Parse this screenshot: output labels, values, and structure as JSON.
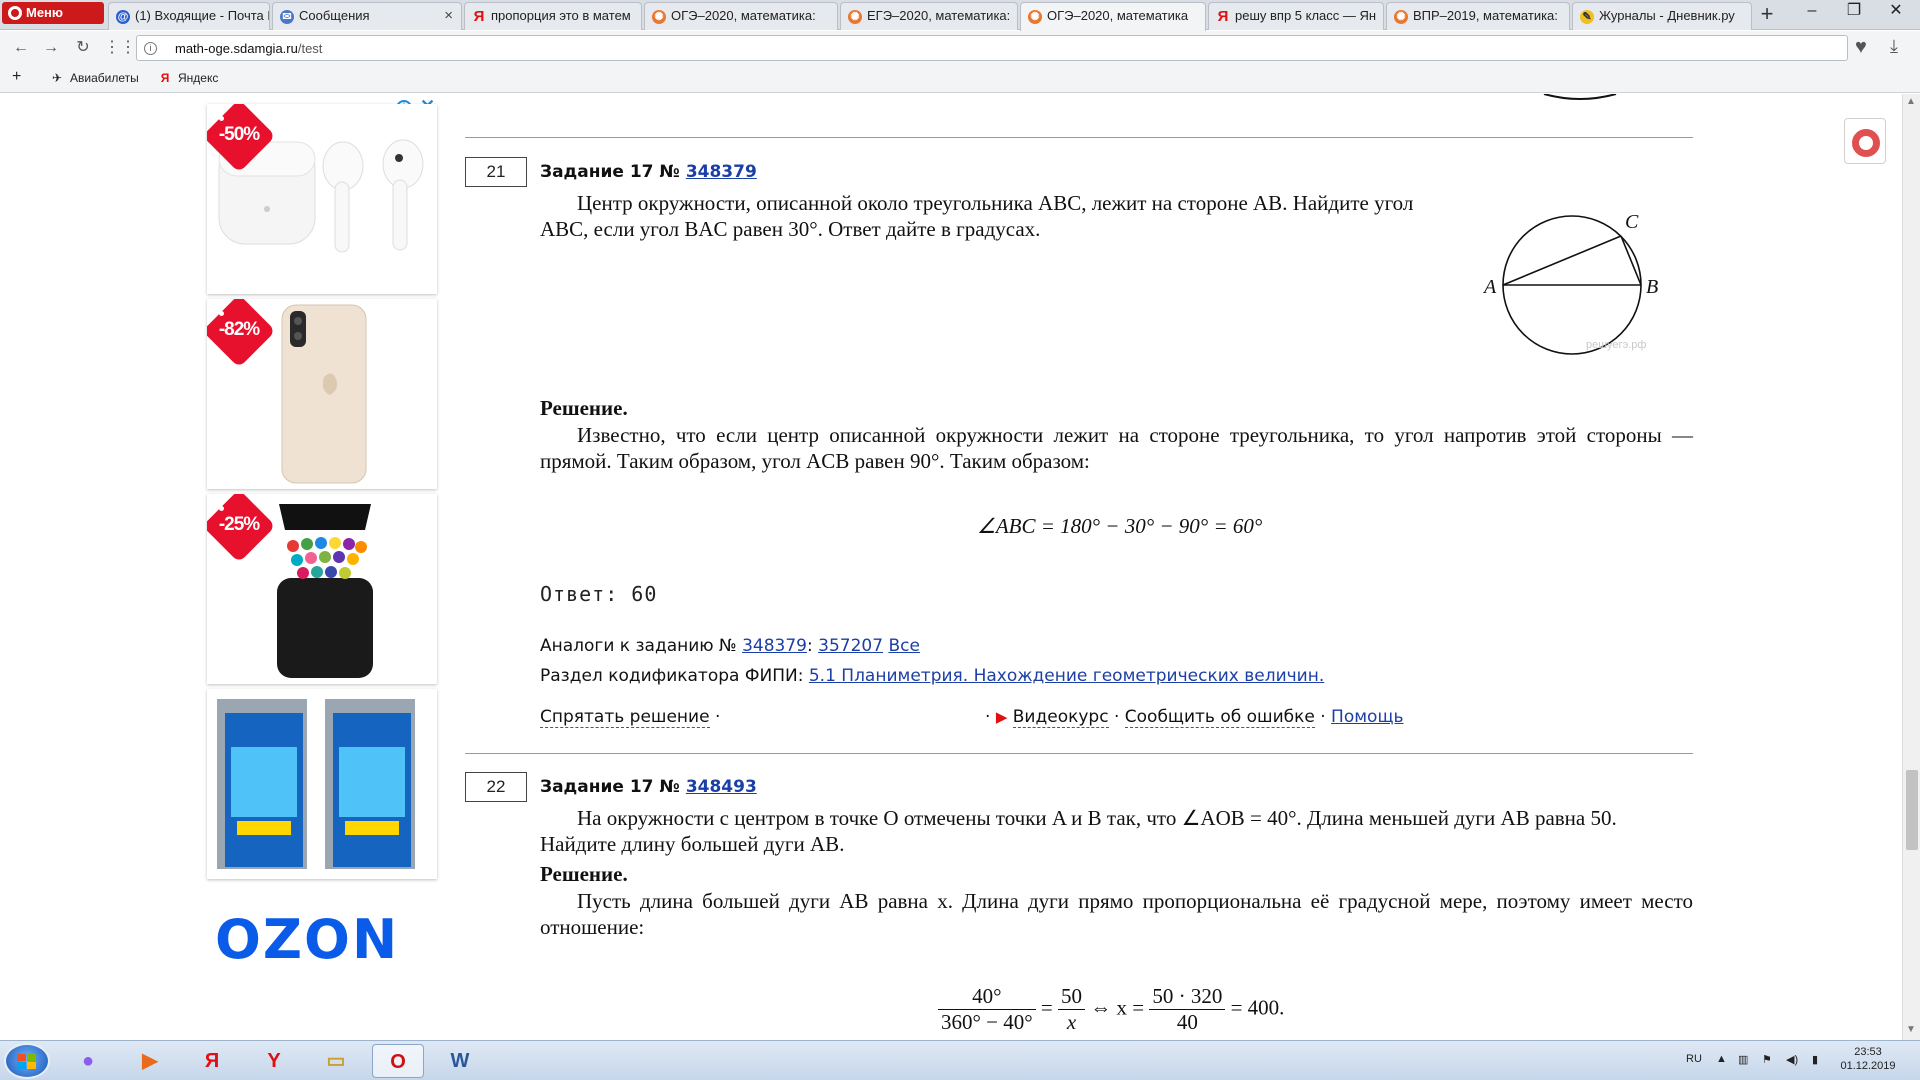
{
  "browser": {
    "menu_label": "Меню",
    "tabs": [
      {
        "label": "(1) Входящие - Почта М",
        "icon": "mail-icon"
      },
      {
        "label": "Сообщения",
        "icon": "messages-icon"
      },
      {
        "label": "пропорция это в матем",
        "icon": "yandex-icon"
      },
      {
        "label": "ОГЭ–2020, математика:",
        "icon": "sdamgia-icon"
      },
      {
        "label": "ЕГЭ–2020, математика:",
        "icon": "sdamgia-icon"
      },
      {
        "label": "ОГЭ–2020, математика",
        "icon": "sdamgia-icon"
      },
      {
        "label": "решу впр 5 класс — Ян",
        "icon": "yandex-icon"
      },
      {
        "label": "ВПР–2019, математика:",
        "icon": "sdamgia-icon"
      },
      {
        "label": "Журналы - Дневник.ру",
        "icon": "dnevnik-icon"
      }
    ],
    "active_tab": 5,
    "url_domain": "math-oge.sdamgia.ru",
    "url_path": "/test",
    "bookmarks": [
      {
        "label": "Авиабилеты",
        "icon": "plane-icon"
      },
      {
        "label": "Яндекс",
        "icon": "yandex-icon"
      }
    ]
  },
  "ads": {
    "items": [
      {
        "discount": "-50%",
        "product": "wireless earbuds"
      },
      {
        "discount": "-82%",
        "product": "phone case"
      },
      {
        "discount": "-25%",
        "product": "markers set"
      },
      {
        "discount": "",
        "product": "trading cards"
      }
    ],
    "brand": "OZON"
  },
  "task21": {
    "number": "21",
    "title_prefix": "Задание 17 № ",
    "id": "348379",
    "condition_1": "Центр окружности, описанной около треугольника ABC, лежит на стороне AB. Найдите угол",
    "condition_2": "ABC, если угол BAC равен 30°. Ответ дайте в градусах.",
    "figure_labels": {
      "a": "A",
      "b": "B",
      "c": "C",
      "watermark": "решуегэ.рф"
    },
    "solution_title": "Решение.",
    "solution_text": "Известно, что если центр описанной окружности лежит на стороне треугольника, то угол напротив этой стороны — прямой. Таким образом, угол ACB равен 90°. Таким образом:",
    "formula": "∠ABC = 180° − 30° − 90° = 60°",
    "answer": "Ответ: 60",
    "analogs_label": "Аналоги к заданию № ",
    "analogs_id": "348379",
    "analogs_sep": ": ",
    "analog_1": "357207",
    "analogs_all": "Все",
    "codifier_label": "Раздел кодификатора ФИПИ: ",
    "codifier_link": "5.1 Планиметрия. Нахождение геометрических величин.",
    "hide_solution": "Спрятать решение",
    "video": "Видеокурс",
    "report": "Сообщить об ошибке",
    "help": "Помощь"
  },
  "task22": {
    "number": "22",
    "title_prefix": "Задание 17 № ",
    "id": "348493",
    "condition_1": "На окружности с центром в точке  O отмечены точки  A и  B так, что  ∠AOB = 40°. Длина меньшей дуги  AB равна 50.",
    "condition_2": "Найдите длину большей дуги AB.",
    "solution_title": "Решение.",
    "solution_text": "Пусть длина большей дуги AB равна  x. Длина дуги прямо пропорциональна её градусной мере, поэтому имеет место отношение:",
    "f_n1": "40°",
    "f_d1": "360° − 40°",
    "f_eq1": " = ",
    "f_n2": "50",
    "f_d2": "x",
    "f_mid": " ⇔ x = ",
    "f_n3": "50 · 320",
    "f_d3": "40",
    "f_end": " = 400."
  },
  "taskbar": {
    "lang": "RU",
    "time": "23:53",
    "date": "01.12.2019"
  }
}
